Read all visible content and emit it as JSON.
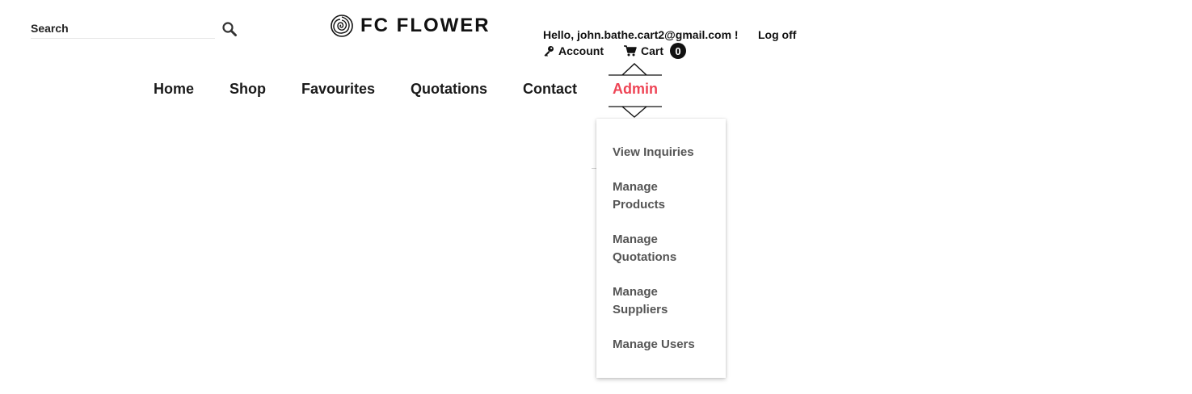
{
  "search": {
    "placeholder": "Search",
    "icon": "search-icon"
  },
  "brand": {
    "name": "FC FLOWER",
    "icon": "rose-logo-icon"
  },
  "user": {
    "greeting": "Hello, john.bathe.cart2@gmail.com !",
    "logoff_label": "Log off",
    "account_label": "Account",
    "cart_label": "Cart",
    "cart_count": "0"
  },
  "nav": {
    "items": [
      {
        "label": "Home"
      },
      {
        "label": "Shop"
      },
      {
        "label": "Favourites"
      },
      {
        "label": "Quotations"
      },
      {
        "label": "Contact"
      },
      {
        "label": "Admin"
      }
    ],
    "active": "Admin",
    "active_color": "#ee4455"
  },
  "admin_menu": {
    "items": [
      {
        "label": "View Inquiries"
      },
      {
        "label": "Manage Products"
      },
      {
        "label": "Manage Quotations"
      },
      {
        "label": "Manage Suppliers"
      },
      {
        "label": "Manage Users"
      }
    ]
  }
}
